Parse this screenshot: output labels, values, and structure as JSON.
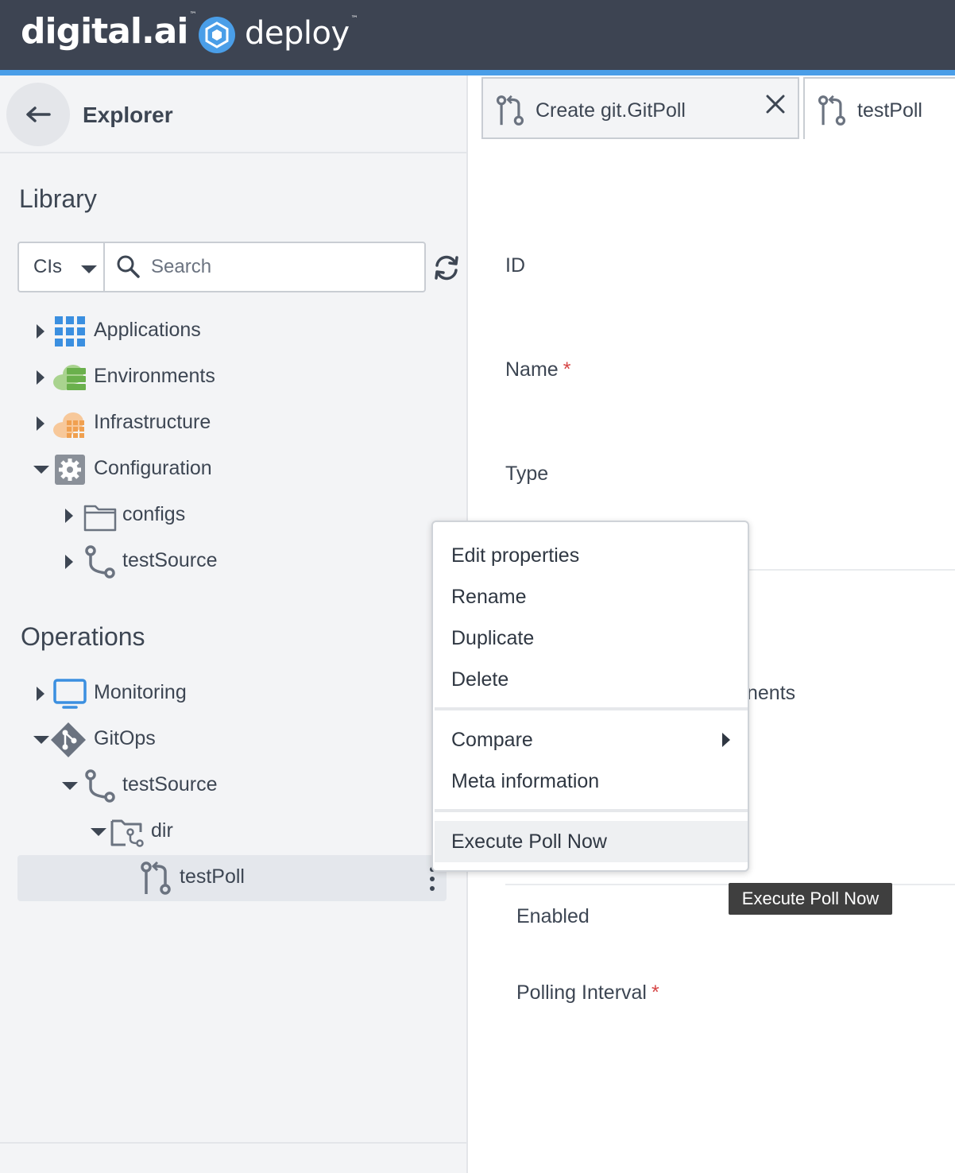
{
  "header": {
    "brand": "digital.ai",
    "product": "deploy",
    "trademark": "™"
  },
  "sidebar": {
    "title": "Explorer",
    "library_title": "Library",
    "operations_title": "Operations",
    "search": {
      "type_value": "CIs",
      "placeholder": "Search"
    },
    "library_items": [
      {
        "label": "Applications",
        "icon": "applications-grid-icon",
        "expanded": false
      },
      {
        "label": "Environments",
        "icon": "environments-cloud-icon",
        "expanded": false
      },
      {
        "label": "Infrastructure",
        "icon": "infrastructure-cloud-icon",
        "expanded": false
      },
      {
        "label": "Configuration",
        "icon": "configuration-gear-icon",
        "expanded": true
      },
      {
        "label": "configs",
        "icon": "folder-icon",
        "expanded": false
      },
      {
        "label": "testSource",
        "icon": "git-source-icon",
        "expanded": false
      }
    ],
    "operations_items": [
      {
        "label": "Monitoring",
        "icon": "monitor-icon",
        "expanded": false
      },
      {
        "label": "GitOps",
        "icon": "git-diamond-icon",
        "expanded": true
      },
      {
        "label": "testSource",
        "icon": "git-source-icon",
        "expanded": true
      },
      {
        "label": "dir",
        "icon": "git-folder-icon",
        "expanded": true
      },
      {
        "label": "testPoll",
        "icon": "git-poll-icon",
        "selected": true
      }
    ]
  },
  "tabs": [
    {
      "label": "Create git.GitPoll",
      "icon": "git-poll-icon",
      "closable": true
    },
    {
      "label": "testPoll",
      "icon": "git-poll-icon",
      "active": true
    }
  ],
  "form": {
    "id_label": "ID",
    "name_label": "Name",
    "type_label": "Type",
    "partial_label": "nents",
    "enabled_label": "Enabled",
    "polling_label": "Polling Interval",
    "required_mark": "*"
  },
  "context_menu": {
    "group1": [
      "Edit properties",
      "Rename",
      "Duplicate",
      "Delete"
    ],
    "group2": [
      "Compare",
      "Meta information"
    ],
    "group3": [
      "Execute Poll Now"
    ]
  },
  "tooltip": "Execute Poll Now",
  "colors": {
    "header_bg": "#3d4452",
    "accent": "#4a9ee8",
    "sidebar_bg": "#f3f4f6",
    "required": "#d64545",
    "applications": "#3b8fe0",
    "environments": "#6ab04c",
    "infrastructure": "#f0a050"
  }
}
